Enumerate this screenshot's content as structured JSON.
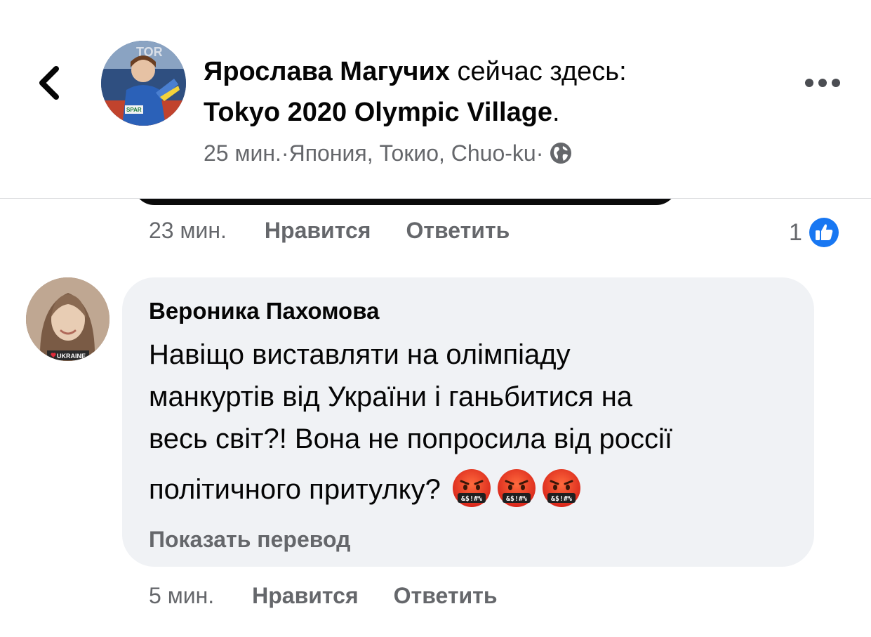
{
  "post_header": {
    "author_name": "Ярослава Магучих",
    "status_text": " сейчас здесь:",
    "place_name": "Tokyo 2020 Olympic Village",
    "place_suffix": ".",
    "time": "25 мин.",
    "separator": " · ",
    "location": "Япония, Токио, Chuo-ku",
    "audience_icon": "globe-icon",
    "back_icon": "chevron-left-icon",
    "more_icon": "more-horizontal-icon"
  },
  "previous_comment": {
    "time": "23 мин.",
    "like_label": "Нравится",
    "reply_label": "Ответить",
    "reaction_count": "1",
    "reaction_icon": "like-icon"
  },
  "comment": {
    "author": "Вероника Пахомова",
    "text_lines": [
      "Навіщо виставляти на олімпіаду",
      "манкуртів від України і ганьбитися на",
      "весь світ?! Вона не попросила від россії",
      "політичного притулку?"
    ],
    "emoji_icon": "face-with-symbols-on-mouth-emoji",
    "emoji_count": 3,
    "translate_label": "Показать перевод",
    "time": "5 мин.",
    "like_label": "Нравится",
    "reply_label": "Ответить",
    "avatar_badge": "UKRAINE"
  },
  "colors": {
    "secondary_text": "#65676b",
    "bubble_bg": "#f0f2f5",
    "like_blue": "#1877f2"
  }
}
